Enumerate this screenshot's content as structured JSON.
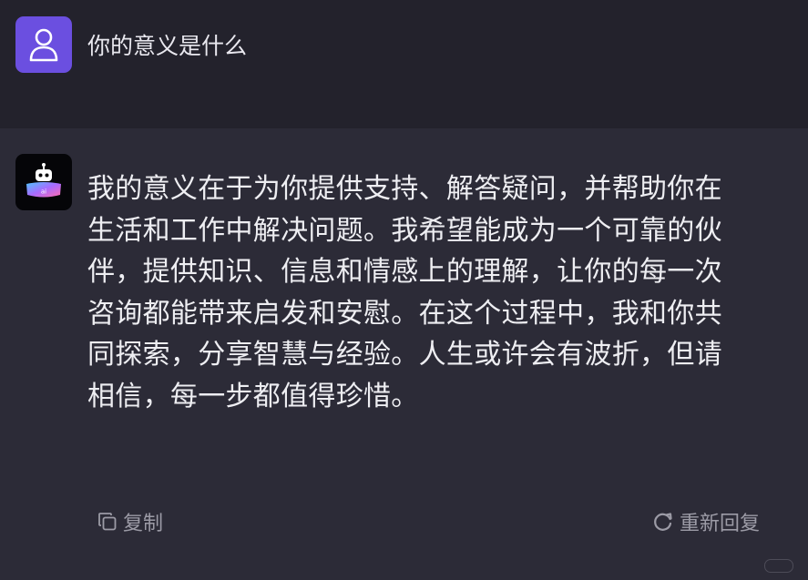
{
  "user": {
    "avatar_icon": "person-icon",
    "message": "你的意义是什么"
  },
  "assistant": {
    "avatar_icon": "robot-ai-icon",
    "avatar_label": "ai",
    "lines": [
      "我的意义在于为你提供支持、解答疑问，并帮助你在",
      "生活和工作中解决问题。我希望能成为一个可靠的伙",
      "伴，提供知识、信息和情感上的理解，让你的每一次",
      "咨询都能带来启发和安慰。在这个过程中，我和你共",
      "同探索，分享智慧与经验。人生或许会有波折，但请",
      "相信，每一步都值得珍惜。"
    ]
  },
  "actions": {
    "copy_label": "复制",
    "copy_icon": "copy-icon",
    "regenerate_label": "重新回复",
    "regenerate_icon": "refresh-icon"
  },
  "colors": {
    "user_avatar_bg": "#6b4fe0",
    "header_bg": "#23222c",
    "body_bg": "#2c2b37"
  }
}
